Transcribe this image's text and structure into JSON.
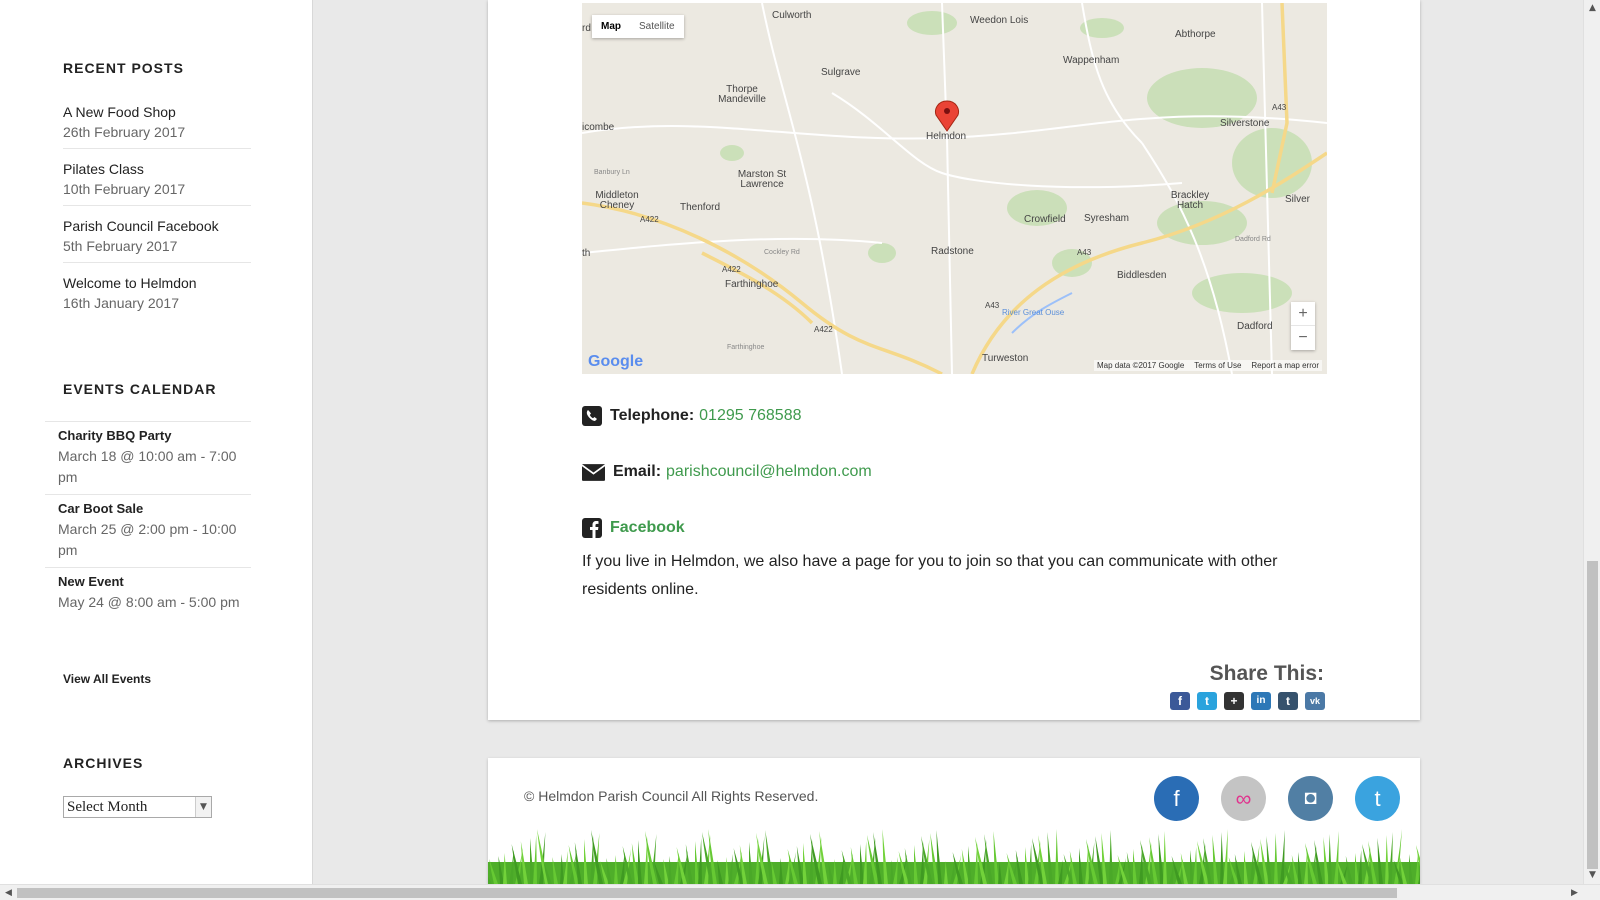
{
  "sidebar": {
    "recent_posts_title": "RECENT POSTS",
    "recent_posts": [
      {
        "title": "A New Food Shop",
        "date": "26th February 2017"
      },
      {
        "title": "Pilates Class",
        "date": "10th February 2017"
      },
      {
        "title": "Parish Council Facebook",
        "date": "5th February 2017"
      },
      {
        "title": "Welcome to Helmdon",
        "date": "16th January 2017"
      }
    ],
    "events_title": "EVENTS CALENDAR",
    "events": [
      {
        "title": "Charity BBQ Party",
        "date": "March 18 @ 10:00 am - 7:00 pm"
      },
      {
        "title": "Car Boot Sale",
        "date": "March 25 @ 2:00 pm - 10:00 pm"
      },
      {
        "title": "New Event",
        "date": "May 24 @ 8:00 am - 5:00 pm"
      }
    ],
    "view_all_events": "View All Events",
    "archives_title": "ARCHIVES",
    "archives_select": "Select Month"
  },
  "map": {
    "type_map": "Map",
    "type_satellite": "Satellite",
    "zoom_in": "+",
    "zoom_out": "−",
    "google": "Google",
    "map_data": "Map data ©2017 Google",
    "terms": "Terms of Use",
    "report": "Report a map error",
    "places": {
      "culworth": "Culworth",
      "weedon_lois": "Weedon Lois",
      "abthorpe": "Abthorpe",
      "sulgrave": "Sulgrave",
      "wappenham": "Wappenham",
      "thorpe": "Thorpe Mandeville",
      "helmdon": "Helmdon",
      "silverstone": "Silverstone",
      "icombe": "icombe",
      "marston": "Marston St Lawrence",
      "middleton": "Middleton Cheney",
      "thenford": "Thenford",
      "brackley_hatch": "Brackley Hatch",
      "silver": "Silver",
      "crowfield": "Crowfield",
      "syresham": "Syresham",
      "radstone": "Radstone",
      "biddlesden": "Biddlesden",
      "farthinghoe": "Farthinghoe",
      "dadford": "Dadford",
      "turweston": "Turweston",
      "th": "th",
      "rd": "rd",
      "a422a": "A422",
      "a422b": "A422",
      "a422c": "A422",
      "a43a": "A43",
      "a43b": "A43",
      "a43c": "A43",
      "banbury_ln": "Banbury Ln",
      "cockley_rd": "Cockley Rd",
      "dadford_rd": "Dadford Rd",
      "river": "River Great Ouse",
      "farthinghoe_rd": "Farthinghoe"
    }
  },
  "contact": {
    "telephone_label": "Telephone:",
    "telephone_value": "01295 768588",
    "email_label": "Email:",
    "email_value": "parishcouncil@helmdon.com",
    "facebook_label": "Facebook",
    "facebook_text": "If you live in Helmdon, we also have a page for you to join so that you can communicate with other residents online."
  },
  "share": {
    "title": "Share This:",
    "facebook": "f",
    "twitter": "t",
    "plus": "+",
    "linkedin": "in",
    "tumblr": "t",
    "vk": "vk"
  },
  "footer": {
    "copyright": "© Helmdon Parish Council All Rights Reserved.",
    "social": {
      "facebook": "f",
      "flickr": "∞",
      "instagram": "◘",
      "twitter": "t"
    }
  },
  "colors": {
    "accent_green": "#3f9a4d",
    "facebook_blue": "#2a6db5",
    "twitter_blue": "#3aa3df"
  }
}
